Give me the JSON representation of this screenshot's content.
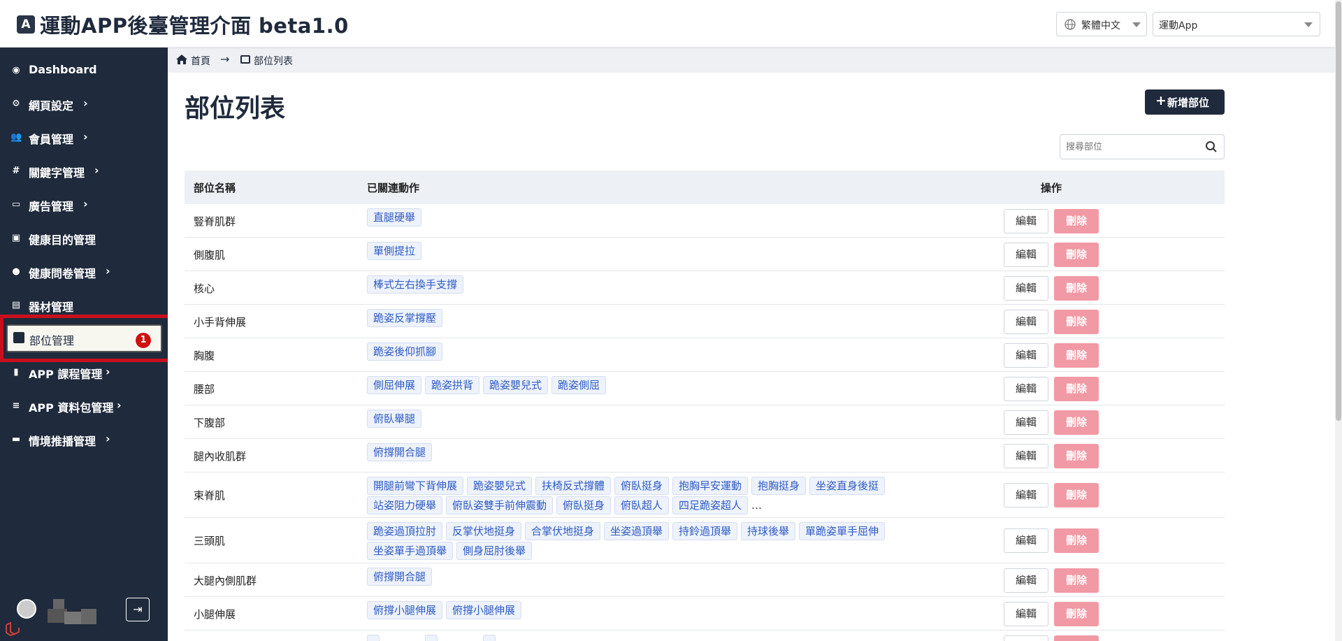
{
  "header": {
    "title": "運動APP後臺管理介面 beta1.0",
    "language": "繁體中文",
    "app": "運動App"
  },
  "sidebar": {
    "items": [
      {
        "label": "Dashboard",
        "icon": "dashboard-icon",
        "has_submenu": false
      },
      {
        "label": "網頁設定",
        "icon": "gear-icon",
        "has_submenu": true
      },
      {
        "label": "會員管理",
        "icon": "users-icon",
        "has_submenu": true
      },
      {
        "label": "關鍵字管理",
        "icon": "hashtag-icon",
        "has_submenu": true
      },
      {
        "label": "廣告管理",
        "icon": "ad-icon",
        "has_submenu": true
      },
      {
        "label": "健康目的管理",
        "icon": "medkit-icon",
        "has_submenu": false
      },
      {
        "label": "健康問卷管理",
        "icon": "comment-icon",
        "has_submenu": true
      },
      {
        "label": "器材管理",
        "icon": "toolbox-icon",
        "has_submenu": false
      },
      {
        "label": "部位管理",
        "icon": "portrait-icon",
        "has_submenu": false,
        "active": true
      },
      {
        "label": "APP 課程管理",
        "icon": "book-icon",
        "has_submenu": true
      },
      {
        "label": "APP 資料包管理",
        "icon": "database-icon",
        "has_submenu": true
      },
      {
        "label": "情境推播管理",
        "icon": "chat-icon",
        "has_submenu": true
      }
    ],
    "annotation_badge": "1"
  },
  "breadcrumb": {
    "home": "首頁",
    "current": "部位列表"
  },
  "main": {
    "page_title": "部位列表",
    "add_button": "新增部位",
    "search_placeholder": "搜尋部位"
  },
  "table": {
    "columns": [
      "部位名稱",
      "已關連動作",
      "操作"
    ],
    "edit_label": "編輯",
    "delete_label": "刪除",
    "rows": [
      {
        "name": "豎脊肌群",
        "tags": [
          "直腿硬舉"
        ]
      },
      {
        "name": "側腹肌",
        "tags": [
          "單側提拉"
        ]
      },
      {
        "name": "核心",
        "tags": [
          "棒式左右換手支撐"
        ]
      },
      {
        "name": "小手背伸展",
        "tags": [
          "跪姿反掌撐壓"
        ]
      },
      {
        "name": "胸腹",
        "tags": [
          "跪姿後仰抓腳"
        ]
      },
      {
        "name": "腰部",
        "tags": [
          "側屈伸展",
          "跪姿拱背",
          "跪姿嬰兒式",
          "跪姿側屈"
        ]
      },
      {
        "name": "下腹部",
        "tags": [
          "俯臥舉腿"
        ]
      },
      {
        "name": "腿內收肌群",
        "tags": [
          "俯撐開合腿"
        ]
      },
      {
        "name": "束脊肌",
        "tags": [
          "開腿前彎下背伸展",
          "跪姿嬰兒式",
          "扶椅反式撐體",
          "俯臥挺身",
          "抱胸早安運動",
          "抱胸挺身",
          "坐姿直身後挺",
          "站姿阻力硬舉",
          "俯臥姿雙手前伸震動",
          "俯臥挺身",
          "俯臥超人",
          "四足跪姿超人"
        ],
        "more": "…"
      },
      {
        "name": "三頭肌",
        "tags": [
          "跪姿過頂拉肘",
          "反掌伏地挺身",
          "合掌伏地挺身",
          "坐姿過頂舉",
          "持鈴過頂舉",
          "持球後舉",
          "單跪姿單手屈伸",
          "坐姿單手過頂舉",
          "側身屈肘後舉"
        ]
      },
      {
        "name": "大腿內側肌群",
        "tags": [
          "俯撐開合腿"
        ]
      },
      {
        "name": "小腿伸展",
        "tags": [
          "俯撐小腿伸展",
          "俯撐小腿伸展"
        ]
      },
      {
        "name": "",
        "tags": [
          "",
          "",
          ""
        ]
      }
    ]
  },
  "colors": {
    "sidebar_bg": "#1f2a3c",
    "delete_btn": "#f199a4",
    "tag_text": "#2d5bc4",
    "annotation_red": "#c8101c"
  }
}
